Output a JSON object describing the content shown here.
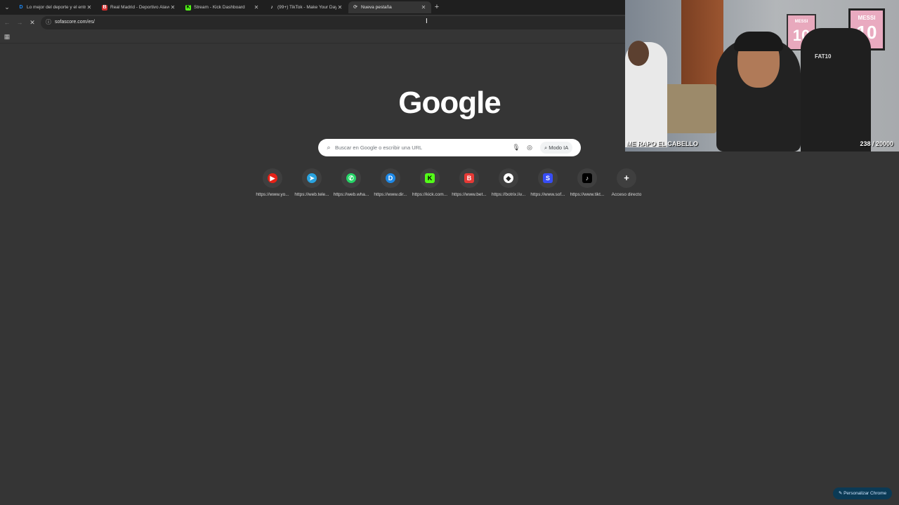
{
  "tabs": [
    {
      "title": "Lo mejor del deporte y el entre",
      "favicon": "dazn-icon",
      "fav_color": "#0b6cff",
      "fav_glyph": "D",
      "active": false
    },
    {
      "title": "Real Madrid - Deportivo Alavés",
      "favicon": "betano-icon",
      "fav_color": "#d32f2f",
      "fav_glyph": "B",
      "active": false
    },
    {
      "title": "Stream - Kick Dashboard",
      "favicon": "kick-icon",
      "fav_color": "#53fc18",
      "fav_glyph": "K",
      "active": false
    },
    {
      "title": "(99+) TikTok - Make Your Day",
      "favicon": "tiktok-icon",
      "fav_color": "#000000",
      "fav_glyph": "♪",
      "active": false
    },
    {
      "title": "Nueva pestaña",
      "favicon": "loading-icon",
      "fav_color": "#353535",
      "fav_glyph": "⟳",
      "active": true
    }
  ],
  "tab_close_glyph": "✕",
  "new_tab_glyph": "+",
  "toolbar": {
    "back_glyph": "←",
    "forward_glyph": "→",
    "stop_glyph": "✕",
    "url": "sofascore.com/es/"
  },
  "google_logo": "Google",
  "search": {
    "placeholder": "Buscar en Google o escribir una URL",
    "modo_ia": "Modo IA"
  },
  "shortcuts": [
    {
      "label": "https://www.yo...",
      "icon": "youtube-icon",
      "color": "#e62117",
      "glyph": "▶"
    },
    {
      "label": "https://web.tele...",
      "icon": "telegram-icon",
      "color": "#2aa3df",
      "glyph": "➤"
    },
    {
      "label": "https://web.wha...",
      "icon": "whatsapp-icon",
      "color": "#25d366",
      "glyph": "✆"
    },
    {
      "label": "https://www.dir...",
      "icon": "directv-icon",
      "color": "#1e88e5",
      "glyph": "D"
    },
    {
      "label": "https://kick.com...",
      "icon": "kick-icon",
      "color": "#53fc18",
      "glyph": "K"
    },
    {
      "label": "https://www.bet...",
      "icon": "betano-icon",
      "color": "#e53935",
      "glyph": "B"
    },
    {
      "label": "https://botrix.liv...",
      "icon": "botrix-icon",
      "color": "#ffffff",
      "glyph": "◆"
    },
    {
      "label": "https://www.sof...",
      "icon": "sofascore-icon",
      "color": "#374df5",
      "glyph": "S"
    },
    {
      "label": "https://www.tikt...",
      "icon": "tiktok-icon",
      "color": "#000000",
      "glyph": "♪"
    },
    {
      "label": "Acceso directo",
      "icon": "add-shortcut-icon",
      "color": "#3f3f3f",
      "glyph": "+"
    }
  ],
  "webcam": {
    "caption": "ME RAPO EL CABELLO",
    "counter": "238 / 20000",
    "jersey_name": "MESSI",
    "jersey_number": "10",
    "chair_text": "FAT10"
  },
  "customize_label": "✎ Personalizar Chrome"
}
